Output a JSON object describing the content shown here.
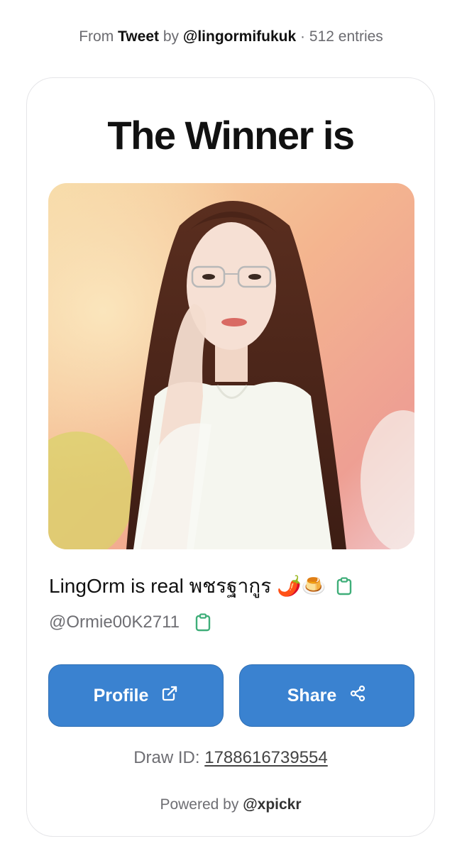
{
  "source": {
    "prefix": "From",
    "kind": "Tweet",
    "by_word": "by",
    "author": "@lingormifukuk",
    "separator": "·",
    "entries": "512 entries"
  },
  "card": {
    "headline": "The Winner is",
    "photo_alt": "winner-profile-photo",
    "winner_name": "LingOrm is real พชรฐากูร 🌶️🍮",
    "winner_handle": "@Ormie00K2711",
    "buttons": {
      "profile_label": "Profile",
      "share_label": "Share"
    },
    "draw": {
      "label": "Draw ID:",
      "id": "1788616739554"
    },
    "powered": {
      "prefix": "Powered by",
      "brand": "@xpickr"
    }
  },
  "colors": {
    "accent": "#3a82d0",
    "clipboard_icon": "#3fae79",
    "text_muted": "#6e6e73"
  },
  "icons": {
    "copy_name": "clipboard-icon",
    "copy_handle": "clipboard-icon",
    "profile": "external-link-icon",
    "share": "share-icon"
  }
}
